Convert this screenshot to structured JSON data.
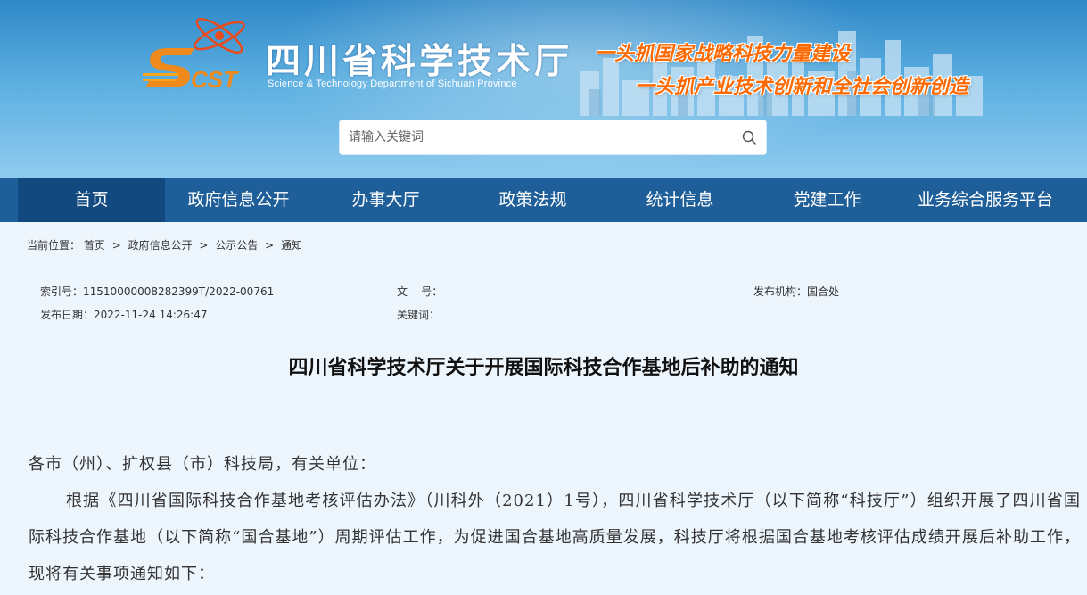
{
  "header": {
    "title": "四川省科学技术厅",
    "subtitle": "Science & Technology Department of Sichuan Province",
    "logo_letters": "SCST",
    "slogan_line1": "一头抓国家战略科技力量建设",
    "slogan_line2": "一头抓产业技术创新和全社会创新创造"
  },
  "search": {
    "placeholder": "请输入关键词",
    "value": ""
  },
  "nav": {
    "items": [
      {
        "label": "首页"
      },
      {
        "label": "政府信息公开"
      },
      {
        "label": "办事大厅"
      },
      {
        "label": "政策法规"
      },
      {
        "label": "统计信息"
      },
      {
        "label": "党建工作"
      },
      {
        "label": "业务综合服务平台"
      }
    ],
    "active_index": 0
  },
  "breadcrumb": {
    "prefix": "当前位置：",
    "items": [
      "首页",
      "政府信息公开",
      "公示公告",
      "通知"
    ],
    "separator": ">"
  },
  "meta": {
    "index_label": "索引号：",
    "index_value": "11510000008282399T/2022-00761",
    "date_label": "发布日期：",
    "date_value": "2022-11-24 14:26:47",
    "docno_label": "文    号：",
    "docno_value": "",
    "keywords_label": "关键词：",
    "keywords_value": "",
    "org_label": "发布机构：",
    "org_value": "国合处"
  },
  "article": {
    "title": "四川省科学技术厅关于开展国际科技合作基地后补助的通知",
    "salutation": "各市（州）、扩权县（市）科技局，有关单位：",
    "paragraph1": "根据《四川省国际科技合作基地考核评估办法》（川科外（2021）1号），四川省科学技术厅（以下简称“科技厅”）组织开展了四川省国际科技合作基地（以下简称“国合基地”）周期评估工作，为促进国合基地高质量发展，科技厅将根据国合基地考核评估成绩开展后补助工作，现将有关事项通知如下："
  },
  "colors": {
    "nav_bg": "#1f5f99",
    "nav_active": "#124a80",
    "slogan": "#ff6a00",
    "page_bg": "#eef6fd"
  }
}
